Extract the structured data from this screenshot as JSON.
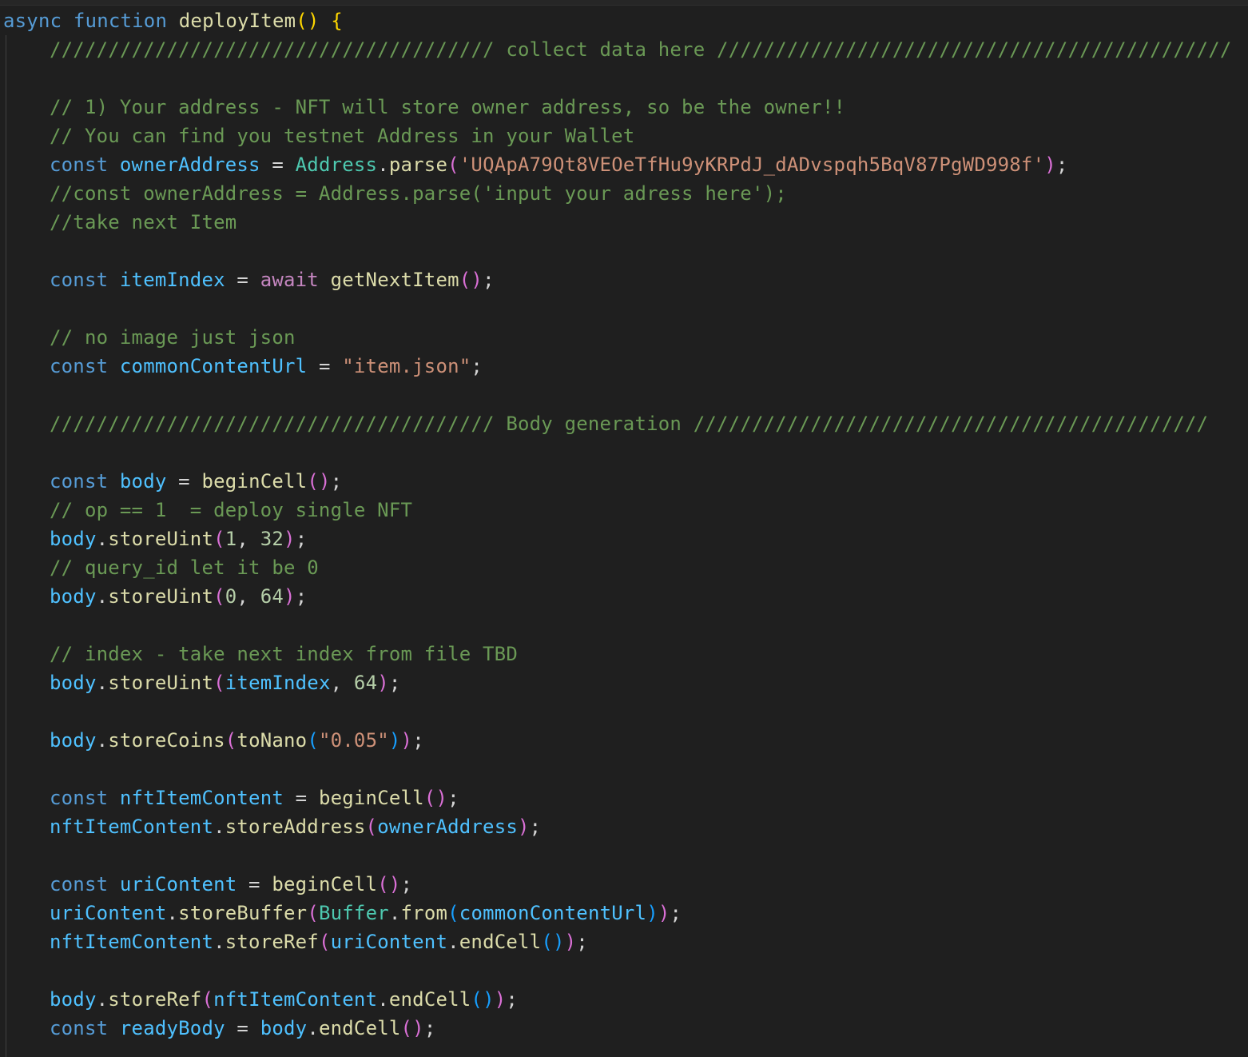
{
  "colors": {
    "background": "#1f1f1f",
    "keyword": "#569cd6",
    "control": "#c586c0",
    "function": "#dcdcaa",
    "variable": "#9cdcfe",
    "constant": "#4fc1ff",
    "type": "#4ec9b0",
    "string": "#ce9178",
    "number": "#b5cea8",
    "comment": "#6a9955",
    "bracket_level1": "#ffd700",
    "bracket_level2": "#da70d6",
    "bracket_level3": "#179fff"
  },
  "code": {
    "kw_async": "async",
    "kw_function": "function",
    "fn_deployItem": "deployItem",
    "kw_const": "const",
    "kw_await": "await",
    "comment_collect": "////////////////////////////////////// collect data here ////////////////////////////////////////////",
    "comment_address1": "// 1) Your address - NFT will store owner address, so be the owner!!",
    "comment_address2": "// You can find you testnet Address in your Wallet",
    "var_ownerAddress": "ownerAddress",
    "type_Address": "Address",
    "fn_parse": "parse",
    "str_address": "'UQApA79Qt8VEOeTfHu9yKRPdJ_dADvspqh5BqV87PgWD998f'",
    "comment_alt_address": "//const ownerAddress = Address.parse('input your adress here');",
    "comment_take_next": "//take next Item",
    "var_itemIndex": "itemIndex",
    "fn_getNextItem": "getNextItem",
    "comment_no_image": "// no image just json",
    "var_commonContentUrl": "commonContentUrl",
    "str_item_json": "\"item.json\"",
    "comment_body_gen": "////////////////////////////////////// Body generation ////////////////////////////////////////////",
    "var_body": "body",
    "fn_beginCell": "beginCell",
    "comment_op": "// op == 1  = deploy single NFT",
    "fn_storeUint": "storeUint",
    "num_1": "1",
    "num_32": "32",
    "comment_query_id": "// query_id let it be 0",
    "num_0": "0",
    "num_64": "64",
    "comment_index": "// index - take next index from file TBD",
    "fn_storeCoins": "storeCoins",
    "fn_toNano": "toNano",
    "str_005": "\"0.05\"",
    "var_nftItemContent": "nftItemContent",
    "fn_storeAddress": "storeAddress",
    "var_uriContent": "uriContent",
    "fn_storeBuffer": "storeBuffer",
    "type_Buffer": "Buffer",
    "fn_from": "from",
    "fn_storeRef": "storeRef",
    "fn_endCell": "endCell",
    "var_readyBody": "readyBody"
  }
}
